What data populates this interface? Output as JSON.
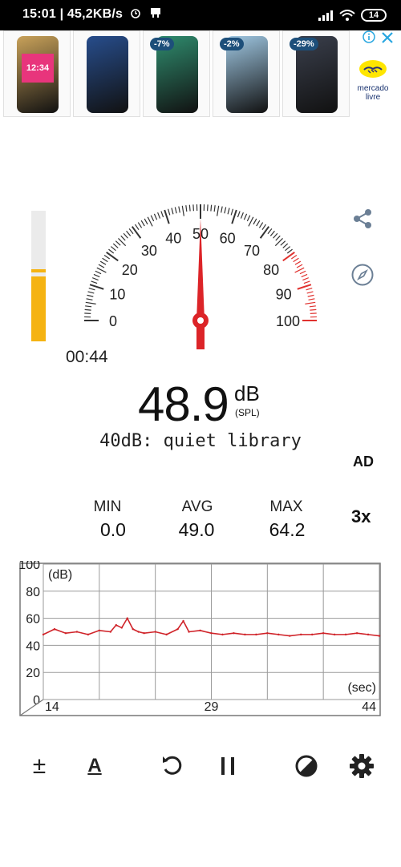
{
  "status_bar": {
    "time": "15:01",
    "network_speed": "45,2KB/s",
    "battery": "14"
  },
  "ad": {
    "products": [
      {
        "badge": "",
        "color": "#c9a25a",
        "screen": "12:34"
      },
      {
        "badge": "",
        "color": "#274d8c",
        "screen": ""
      },
      {
        "badge": "-7%",
        "color": "#2f8c6e",
        "screen": ""
      },
      {
        "badge": "-2%",
        "color": "#9fc7e2",
        "screen": ""
      },
      {
        "badge": "-29%",
        "color": "#3a3f4c",
        "screen": ""
      }
    ],
    "brand_line1": "mercado",
    "brand_line2": "livre"
  },
  "gauge": {
    "labels": [
      "0",
      "10",
      "20",
      "30",
      "40",
      "50",
      "60",
      "70",
      "80",
      "90",
      "100"
    ],
    "needle_db": 50,
    "accent": "#e0322f"
  },
  "level_bar": {
    "level_fraction": 0.5,
    "marker_fraction": 0.53
  },
  "elapsed": "00:44",
  "reading": {
    "value": "48.9",
    "unit": "dB",
    "unit_sub": "(SPL)"
  },
  "reference": "40dB: quiet library",
  "ad_tag": "AD",
  "stats": {
    "min_label": "MIN",
    "min_value": "0.0",
    "avg_label": "AVG",
    "avg_value": "49.0",
    "max_label": "MAX",
    "max_value": "64.2",
    "speed_label": "3x"
  },
  "chart_data": {
    "type": "line",
    "title": "",
    "xlabel": "(sec)",
    "ylabel": "(dB)",
    "x_ticks": [
      "14",
      "29",
      "44"
    ],
    "xlim": [
      14,
      44
    ],
    "y_ticks": [
      "0",
      "20",
      "40",
      "60",
      "80",
      "100"
    ],
    "ylim": [
      0,
      100
    ],
    "grid": true,
    "line_color": "#d0242a",
    "series": [
      {
        "x": [
          14,
          15,
          16,
          17,
          18,
          19,
          20,
          20.5,
          21,
          21.5,
          22,
          22.5,
          23,
          24,
          25,
          26,
          26.5,
          27,
          28,
          29,
          30,
          31,
          32,
          33,
          34,
          35,
          36,
          37,
          38,
          39,
          40,
          41,
          42,
          43,
          44
        ],
        "values": [
          48,
          52,
          49,
          50,
          48,
          51,
          50,
          55,
          53,
          60,
          52,
          50,
          49,
          50,
          48,
          52,
          58,
          50,
          51,
          49,
          48,
          49,
          48,
          48,
          49,
          48,
          47,
          48,
          48,
          49,
          48,
          48,
          49,
          48,
          47
        ]
      }
    ]
  },
  "toolbar": {
    "calibrate_label": "±",
    "weighting_label": "A"
  }
}
